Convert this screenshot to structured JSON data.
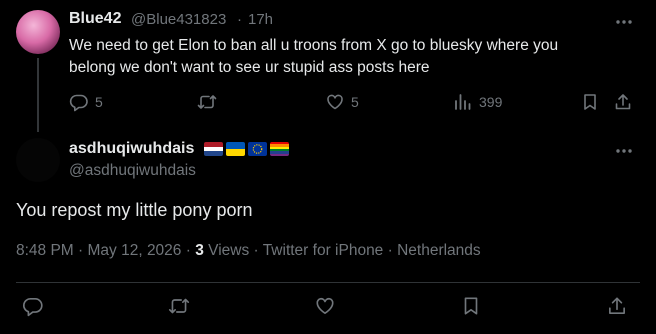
{
  "parent": {
    "name": "Blue42",
    "handle": "@Blue431823",
    "separator": "·",
    "time": "17h",
    "text_line1": "We need to get Elon to ban all u troons from X go to bluesky where you",
    "text_line2": "belong we don't want to see ur stupid ass posts here",
    "replies": "5",
    "likes": "5",
    "views": "399",
    "icons": [
      "reply-icon",
      "retweet-icon",
      "like-icon",
      "views-icon",
      "bookmark-icon",
      "share-icon",
      "more-icon"
    ]
  },
  "reply": {
    "name": "asdhuqiwuhdais",
    "handle": "@asdhuqiwuhdais",
    "flags": [
      "netherlands-flag",
      "ukraine-flag",
      "eu-flag",
      "rainbow-flag"
    ],
    "text": "You repost my little pony porn",
    "time": "8:48 PM · May 12, 2026 · ",
    "views_count": "3",
    "views_label": " Views",
    "source": " · Twitter for iPhone · Netherlands"
  },
  "colors": {
    "background": "#000000",
    "text": "#e7e9ea",
    "muted": "#71767b",
    "divider": "#2f3336"
  }
}
